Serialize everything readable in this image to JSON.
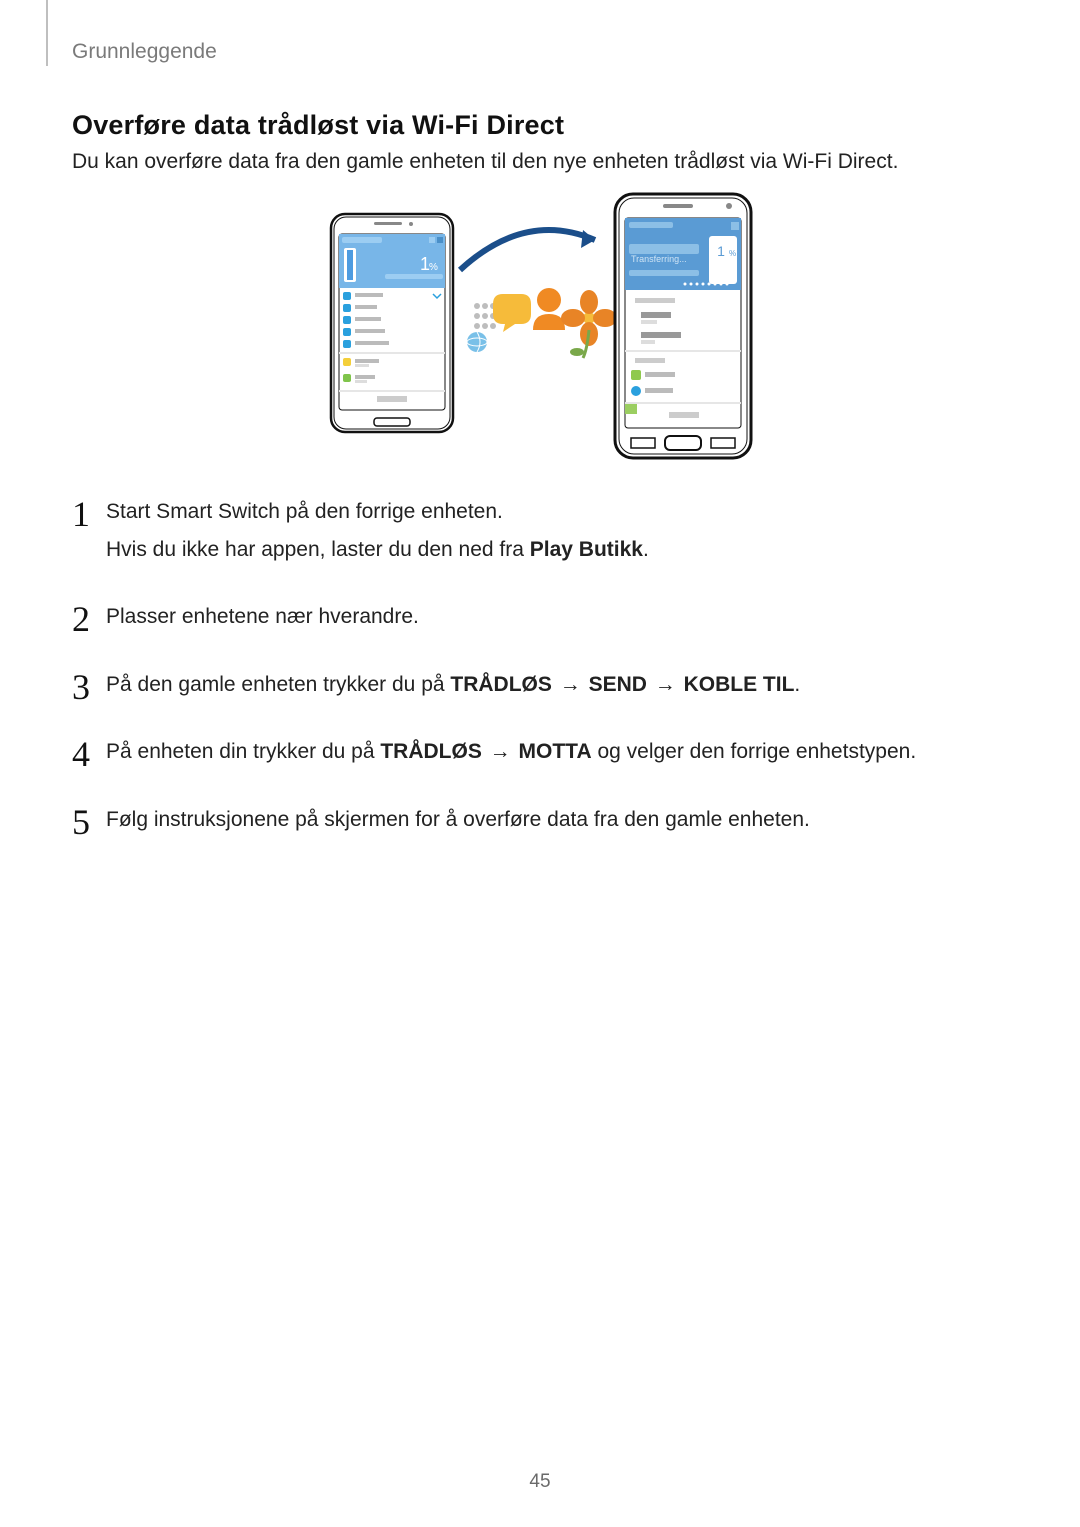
{
  "breadcrumb": "Grunnleggende",
  "section_title": "Overføre data trådløst via Wi-Fi Direct",
  "intro": "Du kan overføre data fra den gamle enheten til den nye enheten trådløst via Wi-Fi Direct.",
  "steps": [
    {
      "num": "1",
      "lines": [
        {
          "parts": [
            {
              "t": "Start Smart Switch på den forrige enheten."
            }
          ]
        },
        {
          "parts": [
            {
              "t": "Hvis du ikke har appen, laster du den ned fra "
            },
            {
              "t": "Play Butikk",
              "bold": true
            },
            {
              "t": "."
            }
          ]
        }
      ]
    },
    {
      "num": "2",
      "lines": [
        {
          "parts": [
            {
              "t": "Plasser enhetene nær hverandre."
            }
          ]
        }
      ]
    },
    {
      "num": "3",
      "lines": [
        {
          "parts": [
            {
              "t": "På den gamle enheten trykker du på "
            },
            {
              "t": "TRÅDLØS",
              "bold": true
            },
            {
              "t": " → ",
              "arrow": true
            },
            {
              "t": "SEND",
              "bold": true
            },
            {
              "t": " → ",
              "arrow": true
            },
            {
              "t": "KOBLE TIL",
              "bold": true
            },
            {
              "t": "."
            }
          ]
        }
      ]
    },
    {
      "num": "4",
      "lines": [
        {
          "parts": [
            {
              "t": "På enheten din trykker du på "
            },
            {
              "t": "TRÅDLØS",
              "bold": true
            },
            {
              "t": " → ",
              "arrow": true
            },
            {
              "t": "MOTTA",
              "bold": true
            },
            {
              "t": " og velger den forrige enhetstypen."
            }
          ]
        }
      ]
    },
    {
      "num": "5",
      "lines": [
        {
          "parts": [
            {
              "t": "Følg instruksjonene på skjermen for å overføre data fra den gamle enheten."
            }
          ]
        }
      ]
    }
  ],
  "page_number": "45",
  "figure": {
    "left_phone_percent": "1",
    "left_phone_percent_suffix": "%",
    "right_phone_percent": "1",
    "right_phone_percent_suffix": "%",
    "right_phone_label": "Transferring..."
  }
}
